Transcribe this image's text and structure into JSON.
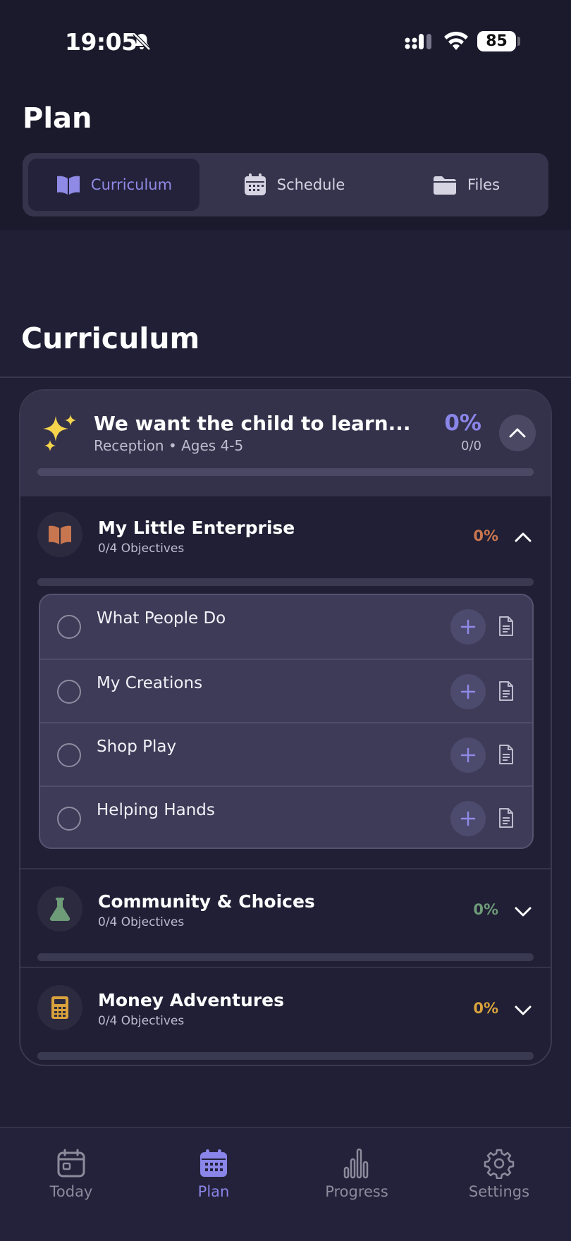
{
  "status_bar": {
    "time": "19:05",
    "battery": "85",
    "icons": [
      "bell-slash-icon",
      "signal-icon",
      "wifi-icon",
      "battery-icon"
    ]
  },
  "header": {
    "title": "Plan",
    "segments": [
      {
        "label": "Curriculum",
        "icon": "book-icon",
        "active": true
      },
      {
        "label": "Schedule",
        "icon": "calendar-icon",
        "active": false
      },
      {
        "label": "Files",
        "icon": "folder-icon",
        "active": false
      }
    ]
  },
  "main": {
    "section_title": "Curriculum",
    "card": {
      "icon": "sparkles-icon",
      "title": "We want the child to learn...",
      "subtitle": "Reception • Ages 4-5",
      "percent": "0%",
      "fraction": "0/0",
      "progress": 0,
      "groups": [
        {
          "title": "My Little Enterprise",
          "subtitle": "0/4 Objectives",
          "percent": "0%",
          "color": "#c8764f",
          "icon": "book-open-icon",
          "expanded": true,
          "progress": 0,
          "objectives": [
            {
              "label": "What People Do"
            },
            {
              "label": "My Creations"
            },
            {
              "label": "Shop Play"
            },
            {
              "label": "Helping Hands"
            }
          ]
        },
        {
          "title": "Community & Choices",
          "subtitle": "0/4 Objectives",
          "percent": "0%",
          "color": "#6e9b78",
          "icon": "flask-icon",
          "expanded": false,
          "progress": 0
        },
        {
          "title": "Money Adventures",
          "subtitle": "0/4 Objectives",
          "percent": "0%",
          "color": "#d9a23c",
          "icon": "calculator-icon",
          "expanded": false,
          "progress": 0
        }
      ]
    }
  },
  "tabbar": {
    "tabs": [
      {
        "label": "Today",
        "icon": "calendar-day-icon",
        "active": false
      },
      {
        "label": "Plan",
        "icon": "calendar-grid-icon",
        "active": true
      },
      {
        "label": "Progress",
        "icon": "bar-chart-icon",
        "active": false
      },
      {
        "label": "Settings",
        "icon": "gear-icon",
        "active": false
      }
    ]
  },
  "colors": {
    "accent": "#8a85e8",
    "background": "#1b1a2c",
    "card": "#34324b"
  }
}
